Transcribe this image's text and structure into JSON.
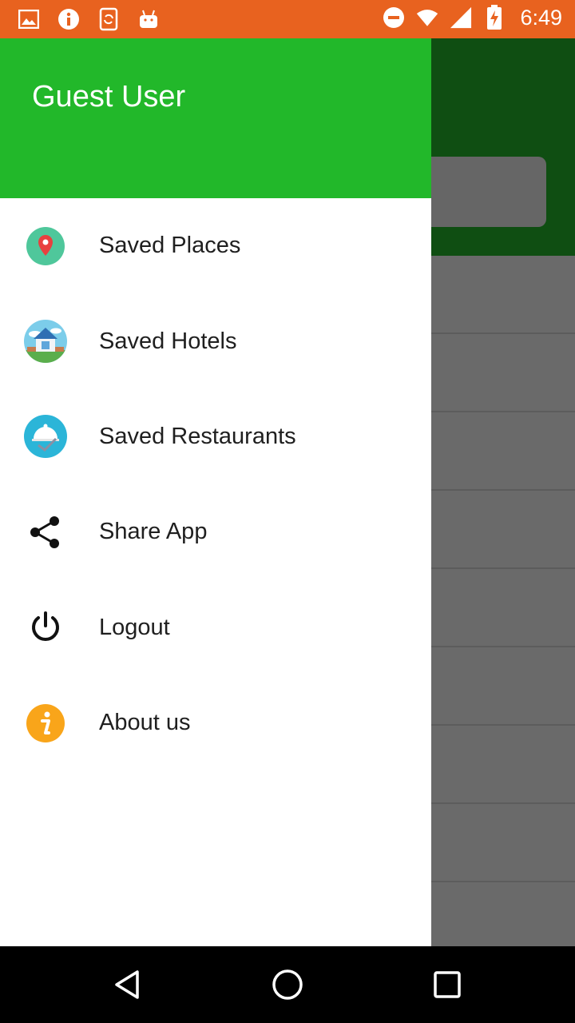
{
  "status_bar": {
    "time": "6:49",
    "left_icons": [
      "image-icon",
      "info-icon",
      "sync-phone-icon",
      "android-icon"
    ],
    "right_icons": [
      "do-not-disturb-icon",
      "wifi-icon",
      "signal-icon",
      "battery-charging-icon"
    ],
    "color": "#E8621F"
  },
  "drawer": {
    "user_name": "Guest User",
    "header_color": "#22B82A",
    "items": [
      {
        "label": "Saved Places",
        "icon": "map-pin-icon"
      },
      {
        "label": "Saved Hotels",
        "icon": "house-icon"
      },
      {
        "label": "Saved Restaurants",
        "icon": "food-cloche-icon"
      },
      {
        "label": "Share App",
        "icon": "share-icon"
      },
      {
        "label": "Logout",
        "icon": "power-icon"
      },
      {
        "label": "About us",
        "icon": "info-icon"
      }
    ]
  },
  "nav_bar": {
    "buttons": [
      "back-icon",
      "home-icon",
      "recents-icon"
    ]
  }
}
